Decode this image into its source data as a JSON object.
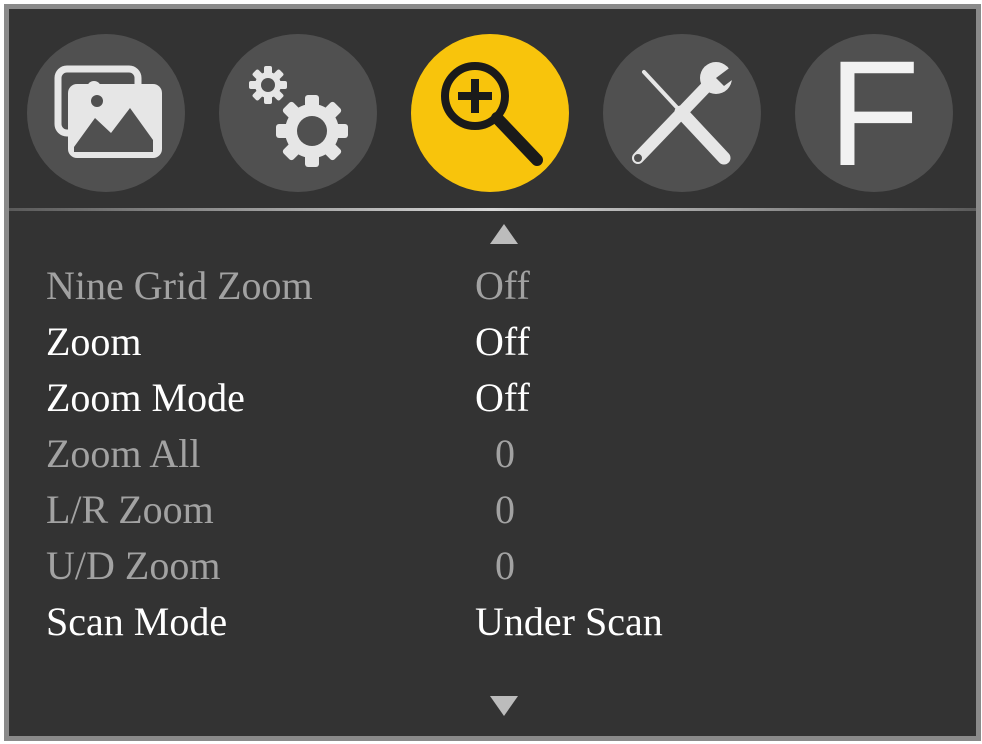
{
  "tabs": [
    {
      "id": "picture",
      "icon": "picture-icon",
      "active": false
    },
    {
      "id": "settings",
      "icon": "gears-icon",
      "active": false
    },
    {
      "id": "zoom",
      "icon": "zoom-in-icon",
      "active": true
    },
    {
      "id": "tools",
      "icon": "tools-icon",
      "active": false
    },
    {
      "id": "function",
      "icon": "function-f-icon",
      "label": "F",
      "active": false
    }
  ],
  "colors": {
    "background": "#333333",
    "active_tab": "#f8c40c",
    "tab": "#505050",
    "text_enabled": "#ffffff",
    "text_disabled": "#a2a2a2"
  },
  "menu": {
    "scroll_up": "up-arrow-icon",
    "scroll_down": "down-arrow-icon",
    "items": [
      {
        "label": "Nine Grid Zoom",
        "value": "Off",
        "enabled": false
      },
      {
        "label": "Zoom",
        "value": "Off",
        "enabled": true
      },
      {
        "label": "Zoom Mode",
        "value": "Off",
        "enabled": true
      },
      {
        "label": "Zoom All",
        "value": "0",
        "enabled": false
      },
      {
        "label": "L/R Zoom",
        "value": "0",
        "enabled": false
      },
      {
        "label": "U/D Zoom",
        "value": "0",
        "enabled": false
      },
      {
        "label": "Scan Mode",
        "value": "Under Scan",
        "enabled": true
      }
    ]
  }
}
